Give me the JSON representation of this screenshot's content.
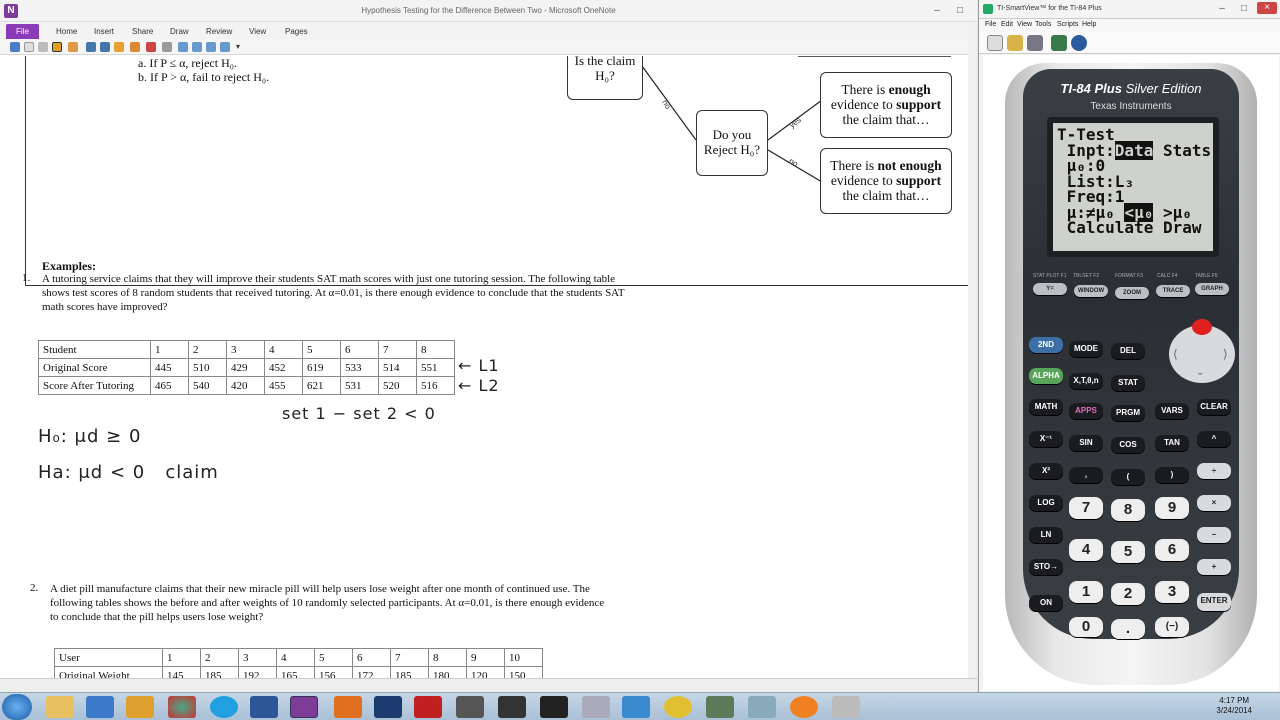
{
  "onenote": {
    "window_title": "Hypothesis Testing for the Difference Between Two  - Microsoft OneNote",
    "tabs": [
      "File",
      "Home",
      "Insert",
      "Share",
      "Draw",
      "Review",
      "View",
      "Pages"
    ],
    "steps": {
      "a": "a.  If P ≤ α, reject H₀.",
      "b": "b.  If P > α, fail to reject H₀."
    },
    "flowchart": {
      "claim_box": "Is the claim H₀?",
      "reject_box": "Do you Reject H₀?",
      "no_label": "no",
      "yes_label": "yes",
      "no2_label": "no",
      "support_box": {
        "pre": "There is ",
        "bold1": "enough",
        "mid": " evidence to ",
        "bold2": "support",
        "post": " the claim that…"
      },
      "not_support_box": {
        "pre": "There is ",
        "bold1": "not enough",
        "mid": " evidence to ",
        "bold2": "support",
        "post": " the claim that…"
      }
    },
    "examples_title": "Examples:",
    "q1": {
      "num": "1.",
      "text": "A tutoring service claims that they will improve their students SAT math scores with just one tutoring session. The following table shows test scores of 8 random students that received tutoring. At α=0.01, is there enough evidence to conclude that the students SAT math scores have improved?",
      "table": [
        [
          "Student",
          "1",
          "2",
          "3",
          "4",
          "5",
          "6",
          "7",
          "8"
        ],
        [
          "Original  Score",
          "445",
          "510",
          "429",
          "452",
          "619",
          "533",
          "514",
          "551"
        ],
        [
          "Score After Tutoring",
          "465",
          "540",
          "420",
          "455",
          "621",
          "531",
          "520",
          "516"
        ]
      ],
      "handwriting": {
        "l1": "← L1",
        "l2": "← L2",
        "set": "set 1 − set 2 < 0",
        "h0": "H₀: μd ≥ 0",
        "ha": "Ha: μd < 0   claim"
      }
    },
    "q2": {
      "num": "2.",
      "text": "A diet pill manufacture claims that their new miracle pill will help users lose weight after one month of continued use. The following tables shows the before and after weights of 10 randomly selected participants. At α=0.01, is there enough evidence to conclude that the pill helps users lose weight?",
      "table": [
        [
          "User",
          "1",
          "2",
          "3",
          "4",
          "5",
          "6",
          "7",
          "8",
          "9",
          "10"
        ],
        [
          "Original Weight",
          "145",
          "185",
          "192",
          "165",
          "156",
          "172",
          "185",
          "180",
          "120",
          "150"
        ]
      ]
    }
  },
  "ti": {
    "window_title": "TI-SmartView™ for the TI-84 Plus",
    "menu": [
      "File",
      "Edit",
      "View",
      "Tools",
      "Scripts",
      "Help"
    ],
    "brand_model": "TI-84 Plus",
    "brand_edition": " Silver Edition",
    "brand_maker": "Texas Instruments",
    "screen": {
      "line1": "T-Test",
      "line2_pre": " Inpt:",
      "line2_inv": "Data",
      "line2_post": " Stats",
      "line3": " μ₀:0",
      "line4": " List:L₃",
      "line5": " Freq:1",
      "line6_pre": " μ:≠μ₀ ",
      "line6_inv": "<μ₀",
      "line6_post": " >μ₀",
      "line7": " Calculate Draw"
    },
    "fkeys": [
      "Y=",
      "WINDOW",
      "ZOOM",
      "TRACE",
      "GRAPH"
    ],
    "fkey_labels": [
      "STAT PLOT F1",
      "TBLSET F2",
      "FORMAT F3",
      "CALC F4",
      "TABLE F5"
    ],
    "row1": [
      "2ND",
      "MODE",
      "DEL"
    ],
    "row2": [
      "ALPHA",
      "X,T,θ,n",
      "STAT"
    ],
    "row3": [
      "MATH",
      "APPS",
      "PRGM",
      "VARS",
      "CLEAR"
    ],
    "row4": [
      "X⁻¹",
      "SIN",
      "COS",
      "TAN",
      "^"
    ],
    "row5": [
      "X²",
      ",",
      "(",
      ")",
      "÷"
    ],
    "row6": [
      "LOG",
      "7",
      "8",
      "9",
      "×"
    ],
    "row7": [
      "LN",
      "4",
      "5",
      "6",
      "−"
    ],
    "row8": [
      "STO→",
      "1",
      "2",
      "3",
      "+"
    ],
    "row9": [
      "ON",
      "0",
      ".",
      "(−)",
      "ENTER"
    ]
  },
  "taskbar": {
    "time": "4:17 PM",
    "date": "3/24/2014"
  }
}
